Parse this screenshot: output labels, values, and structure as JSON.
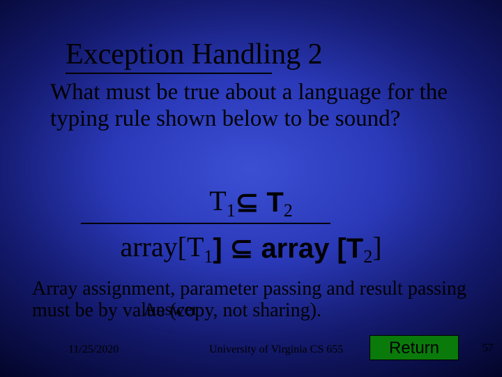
{
  "title": "Exception Handling 2",
  "question": "What must be true about a language for the typing rule shown below to be sound?",
  "rule": {
    "top_before": "T",
    "top_sub1": "1",
    "top_mid": " ⊆  T",
    "top_sub2": "2",
    "bot_before": "array[T",
    "bot_sub1": "1",
    "bot_mid": "] ⊆ array [T",
    "bot_sub2": "2",
    "bot_after": "]"
  },
  "answer_label": "Answer",
  "answer_text": "Array assignment, parameter passing and result passing must be by value (copy, not sharing).",
  "footer": {
    "date": "11/25/2020",
    "affiliation": "University of Virginia CS 655",
    "return_label": "Return",
    "page_number": "57"
  }
}
